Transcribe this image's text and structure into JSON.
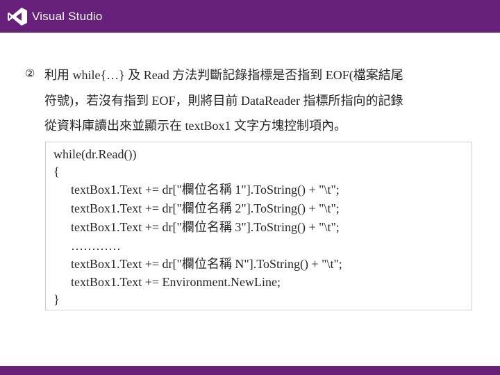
{
  "header": {
    "brand": "Visual Studio",
    "icon": "visual-studio-logo-icon",
    "bar_color": "#68217a"
  },
  "bullet": {
    "marker": "②",
    "lines": [
      "利用 while{…} 及 Read 方法判斷記錄指標是否指到 EOF(檔案結尾",
      "符號)，若沒有指到 EOF，則將目前 DataReader 指標所指向的記錄",
      "從資料庫讀出來並顯示在 textBox1 文字方塊控制項內。"
    ]
  },
  "code": {
    "lines": [
      "while(dr.Read())",
      "{",
      "textBox1.Text += dr[\"欄位名稱 1\"].ToString() + \"\\t\";",
      "textBox1.Text += dr[\"欄位名稱 2\"].ToString() + \"\\t\";",
      "textBox1.Text += dr[\"欄位名稱 3\"].ToString() + \"\\t\";",
      "…………",
      "textBox1.Text += dr[\"欄位名稱 N\"].ToString() + \"\\t\";",
      "textBox1.Text += Environment.NewLine;",
      "}"
    ]
  }
}
